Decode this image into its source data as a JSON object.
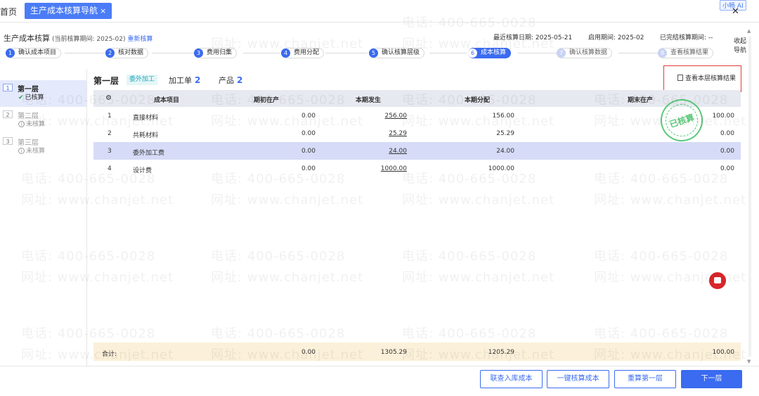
{
  "tabs": {
    "home": "首页",
    "active": "生产成本核算导航",
    "close": "×"
  },
  "assistant": "小畅 AI",
  "window_close": "✕",
  "header": {
    "title": "生产成本核算",
    "period": "(当前核算期间: 2025-02)",
    "recalc": "重新核算",
    "last_date": "最近核算日期: 2025-05-21",
    "enable_period": "启用期间: 2025-02",
    "closed_period": "已完结核算期间: --",
    "collapse_nav": "收起导航"
  },
  "steps": [
    {
      "num": "1",
      "label": "确认成本项目"
    },
    {
      "num": "2",
      "label": "核对数据"
    },
    {
      "num": "3",
      "label": "费用归集"
    },
    {
      "num": "4",
      "label": "费用分配"
    },
    {
      "num": "5",
      "label": "确认核算层级"
    },
    {
      "num": "6",
      "label": "成本核算"
    },
    {
      "num": "7",
      "label": "确认核算数据"
    },
    {
      "num": "8",
      "label": "查看核算结果"
    }
  ],
  "layers": [
    {
      "idx": "1",
      "name": "第一层",
      "status": "已核算"
    },
    {
      "idx": "2",
      "name": "第二层",
      "status": "未核算"
    },
    {
      "idx": "3",
      "name": "第三层",
      "status": "未核算"
    }
  ],
  "main": {
    "layer_title": "第一层",
    "tag": "委外加工",
    "process_order_label": "加工单",
    "process_order_count": "2",
    "product_label": "产品",
    "product_count": "2",
    "view_result": "查看本层核算结果"
  },
  "table": {
    "headers": [
      "成本项目",
      "期初在产",
      "本期发生",
      "本期分配",
      "期末在产"
    ],
    "rows": [
      {
        "no": "1",
        "item": "直接材料",
        "begin": "0.00",
        "occur": "256.00",
        "alloc": "156.00",
        "end": "100.00"
      },
      {
        "no": "2",
        "item": "共耗材料",
        "begin": "0.00",
        "occur": "25.29",
        "alloc": "25.29",
        "end": "0.00"
      },
      {
        "no": "3",
        "item": "委外加工费",
        "begin": "0.00",
        "occur": "24.00",
        "alloc": "24.00",
        "end": "0.00"
      },
      {
        "no": "4",
        "item": "设计费",
        "begin": "0.00",
        "occur": "1000.00",
        "alloc": "1000.00",
        "end": "0.00"
      }
    ],
    "total": {
      "label": "合计:",
      "begin": "0.00",
      "occur": "1305.29",
      "alloc": "1205.29",
      "end": "100.00"
    }
  },
  "stamp": "已核算",
  "buttons": {
    "query_inbound": "联查入库成本",
    "one_click": "一键核算成本",
    "recalc_layer1": "重算第一层",
    "next": "下一层"
  },
  "watermark": {
    "phone": "电话: 400-665-0028",
    "site": "网址: www.chanjet.net"
  },
  "colors": {
    "primary": "#3a6bf0",
    "highlight_row": "#d6dbf7",
    "total_row": "#fbf0d9",
    "stamp": "#3fbf63",
    "alert_border": "#e03c3c"
  }
}
